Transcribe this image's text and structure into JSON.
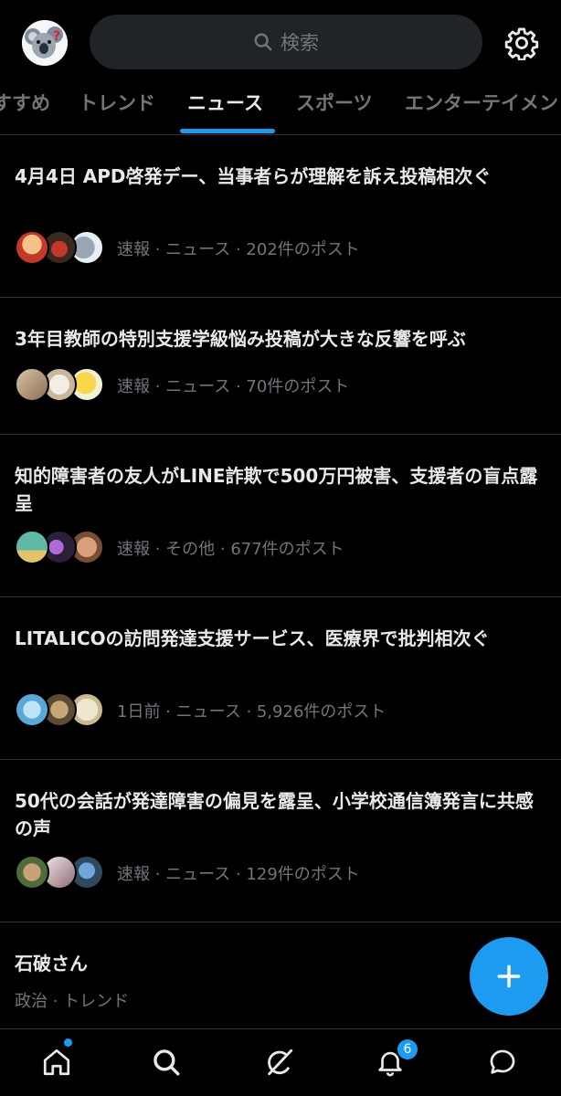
{
  "header": {
    "search_placeholder": "検索"
  },
  "tabs": [
    {
      "label": "すすめ",
      "active": false
    },
    {
      "label": "トレンド",
      "active": false
    },
    {
      "label": "ニュース",
      "active": true
    },
    {
      "label": "スポーツ",
      "active": false
    },
    {
      "label": "エンターテイメン",
      "active": false
    }
  ],
  "items": [
    {
      "title": "4月4日 APD啓発デー、当事者らが理解を訴え投稿相次ぐ",
      "meta": "速報 · ニュース · 202件のポスト"
    },
    {
      "title": "3年目教師の特別支援学級悩み投稿が大きな反響を呼ぶ",
      "meta": "速報 · ニュース · 70件のポスト"
    },
    {
      "title": "知的障害者の友人がLINE詐欺で500万円被害、支援者の盲点露呈",
      "meta": "速報 · その他 · 677件のポスト"
    },
    {
      "title": "LITALICOの訪問発達支援サービス、医療界で批判相次ぐ",
      "meta": "1日前 · ニュース · 5,926件のポスト"
    },
    {
      "title": "50代の会話が発達障害の偏見を露呈、小学校通信簿発言に共感の声",
      "meta": "速報 · ニュース · 129件のポスト"
    },
    {
      "title": "石破さん",
      "meta": "政治 · トレンド"
    }
  ],
  "notifications": {
    "badge": "6"
  },
  "colors": {
    "accent": "#1d9bf0",
    "background": "#000000",
    "muted": "#71767b",
    "text": "#e7e9ea"
  }
}
